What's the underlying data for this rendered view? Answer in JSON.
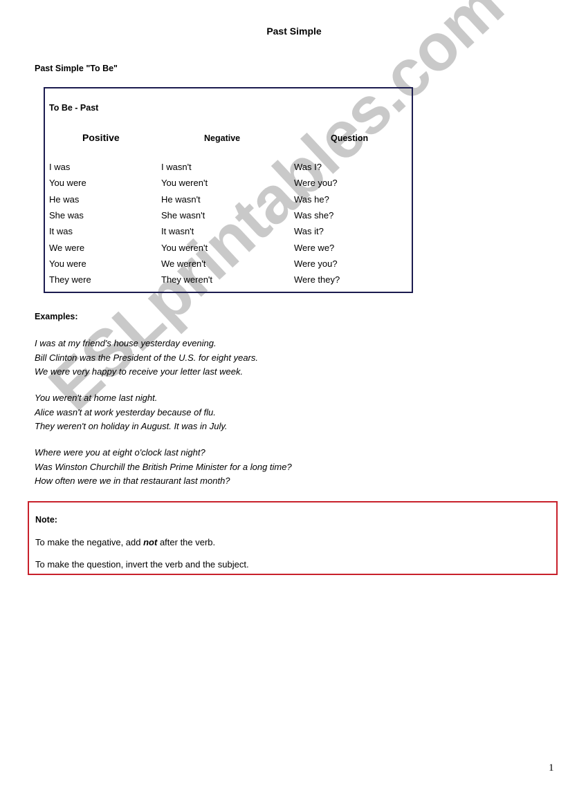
{
  "page": {
    "title": "Past Simple",
    "section_heading": "Past Simple \"To Be\"",
    "page_number": "1",
    "watermark": "ESLprintables.com"
  },
  "table": {
    "title": "To Be - Past",
    "headers": {
      "positive": "Positive",
      "negative": "Negative",
      "question": "Question"
    },
    "rows": [
      {
        "positive": "I was",
        "negative": "I wasn't",
        "question": "Was I?"
      },
      {
        "positive": "You were",
        "negative": "You weren't",
        "question": "Were you?"
      },
      {
        "positive": "He was",
        "negative": "He wasn't",
        "question": "Was he?"
      },
      {
        "positive": "She was",
        "negative": "She wasn't",
        "question": "Was she?"
      },
      {
        "positive": "It was",
        "negative": "It wasn't",
        "question": "Was it?"
      },
      {
        "positive": "We were",
        "negative": "You weren't",
        "question": "Were we?"
      },
      {
        "positive": "You were",
        "negative": "We weren't",
        "question": "Were you?"
      },
      {
        "positive": "They were",
        "negative": "They weren't",
        "question": "Were they?"
      }
    ]
  },
  "examples": {
    "heading": "Examples:",
    "groups": [
      [
        "I was at my friend's house yesterday evening.",
        "Bill Clinton was the President of the U.S. for eight years.",
        "We were very happy to receive your letter last week."
      ],
      [
        "You weren't at home last night.",
        "Alice wasn't at work yesterday because of flu.",
        "They weren't on holiday in August. It was in July."
      ],
      [
        "Where were you at eight o'clock last night?",
        "Was Winston Churchill the British Prime Minister for a long time?",
        "How often were we in that restaurant last month?"
      ]
    ]
  },
  "note": {
    "heading": "Note:",
    "line1_before": "To make the negative, add ",
    "line1_emphasis": "not",
    "line1_after": " after the verb.",
    "line2": "To make the question, invert the verb and the subject."
  },
  "colors": {
    "table_border": "#1b1b4f",
    "note_border": "#c8202a",
    "watermark": "#c9c9c9"
  }
}
